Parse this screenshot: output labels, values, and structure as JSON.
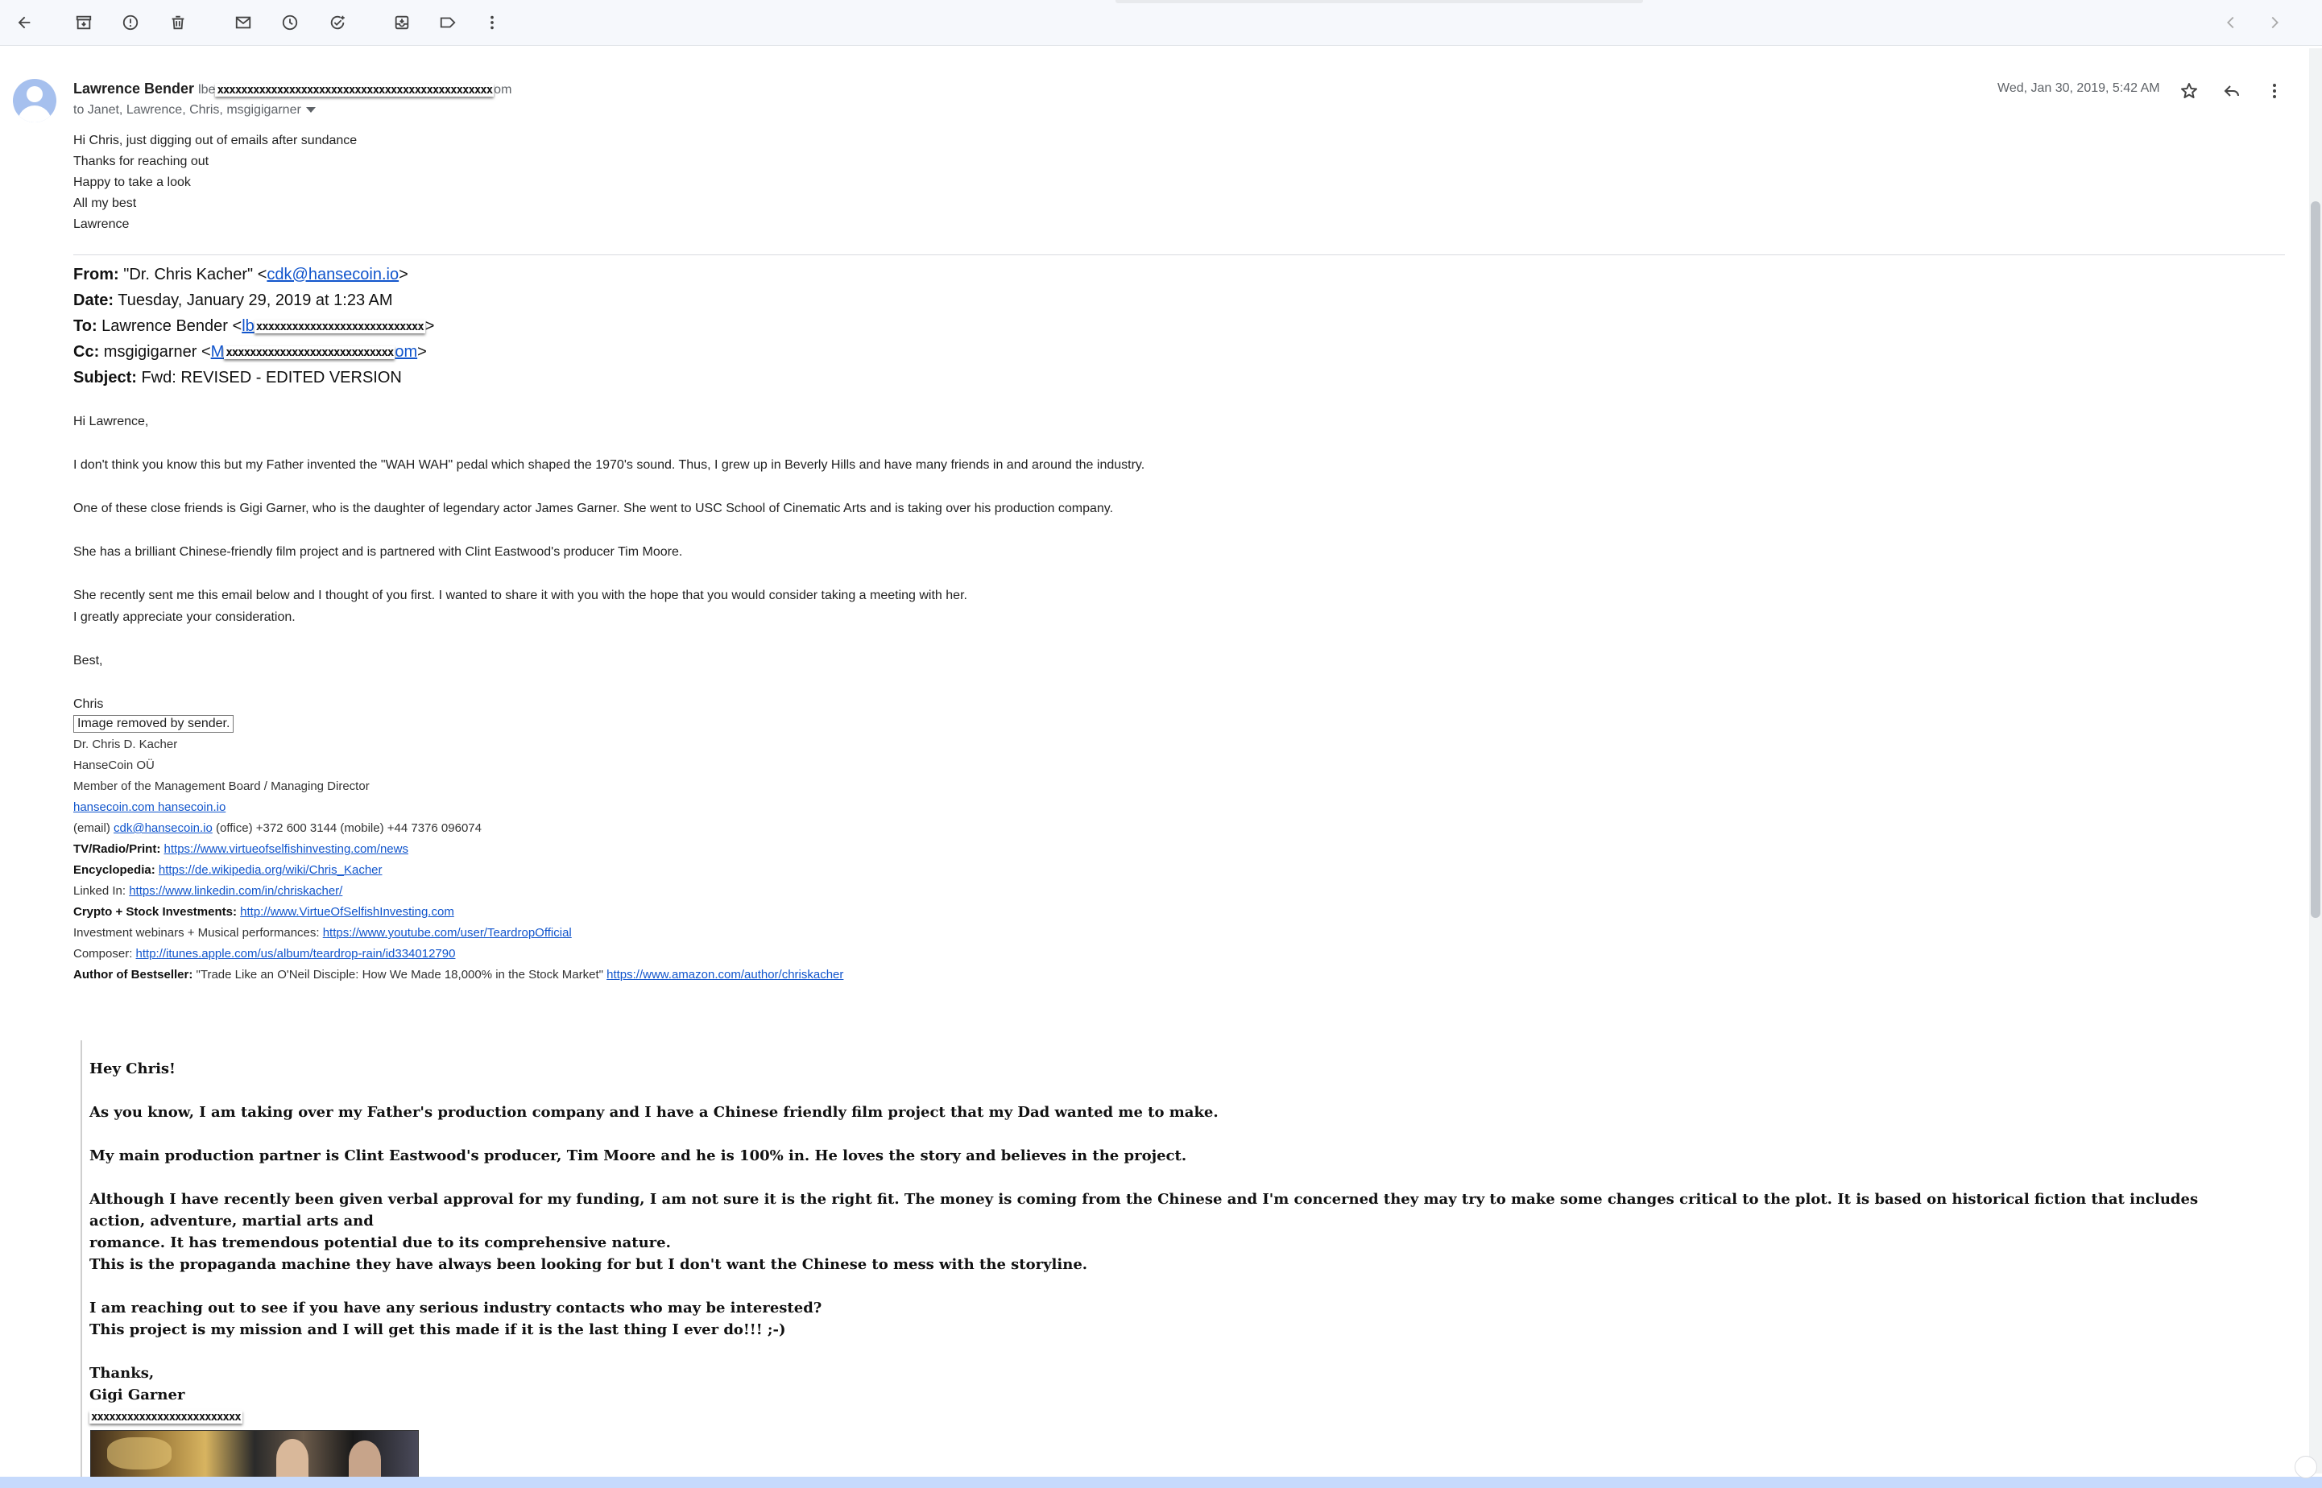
{
  "toolbar": {
    "icons": [
      "back-arrow-icon",
      "archive-icon",
      "report-spam-icon",
      "delete-icon",
      "mark-unread-icon",
      "snooze-icon",
      "add-task-icon",
      "move-to-icon",
      "label-icon",
      "more-vert-icon",
      "prev-chevron-icon",
      "next-chevron-icon"
    ]
  },
  "header": {
    "sender_name": "Lawrence Bender",
    "sender_addr_prefix": "lbe",
    "sender_addr_redacted": "xxxxxxxxxxxxxxxxxxxxxxxxxxxxxxxxxxxxxxxxxxxxxx",
    "sender_addr_suffix": "om",
    "recipients": "to Janet, Lawrence, Chris, msgigigarner",
    "date": "Wed, Jan 30, 2019, 5:42 AM"
  },
  "reply": {
    "lines": [
      "Hi Chris, just digging out of emails after sundance",
      "Thanks for reaching out",
      "Happy to take a look",
      "All my best",
      "Lawrence"
    ]
  },
  "forward": {
    "from_label": "From:",
    "from_value": "\"Dr. Chris Kacher\" <",
    "from_email": "cdk@hansecoin.io",
    "from_close": ">",
    "date_label": "Date:",
    "date_value": "Tuesday, January 29, 2019 at 1:23 AM",
    "to_label": "To:",
    "to_value": "Lawrence Bender <",
    "to_link_start": "lb",
    "to_redacted": "xxxxxxxxxxxxxxxxxxxxxxxxxxxx",
    "to_close": ">",
    "cc_label": "Cc:",
    "cc_value": "msgigigarner <",
    "cc_link_start": "M",
    "cc_redacted": "xxxxxxxxxxxxxxxxxxxxxxxxxxxx",
    "cc_link_end": "om",
    "cc_close": ">",
    "subject_label": "Subject:",
    "subject_value": "Fwd: REVISED - EDITED VERSION"
  },
  "body": {
    "greeting": "Hi Lawrence,",
    "p1": "I don't think you know this but my Father invented the \"WAH WAH\" pedal which shaped the 1970's sound.  Thus, I grew up in Beverly Hills and have many friends in and around the industry.",
    "p2": "One of these close friends is Gigi Garner, who is the daughter of legendary actor James Garner. She went to USC School of Cinematic Arts and is taking over his production company.",
    "p3": "She has a brilliant Chinese-friendly film project and is partnered with Clint Eastwood's producer Tim Moore.",
    "p4a": "She recently sent me this email below and I thought of you first. I wanted to share it with you with the hope that you would consider taking a meeting with her.",
    "p4b": "I greatly appreciate your consideration.",
    "closing": "Best,",
    "name": "Chris"
  },
  "signature": {
    "img_alt": "Image removed by sender.",
    "l1": "Dr. Chris D. Kacher",
    "l2": "HanseCoin OÜ",
    "l3": "Member of the Management Board / Managing Director",
    "l4_link": "hansecoin.com hansecoin.io",
    "l5_a": "(email)   ",
    "l5_link": "cdk@hansecoin.io",
    "l5_b": "   (office)  +372 600 3144  (mobile) +44 7376 096074",
    "l6_label": "TV/Radio/Print:",
    "l6_link": "https://www.virtueofselfishinvesting.com/news",
    "l7_label": "Encyclopedia:",
    "l7_link": "https://de.wikipedia.org/wiki/Chris_Kacher",
    "l8_label": "Linked In:",
    "l8_link": "https://www.linkedin.com/in/chriskacher/",
    "l9_label": "Crypto + Stock Investments:",
    "l9_link": "http://www.VirtueOfSelfishInvesting.com",
    "l10_label": "Investment webinars + Musical performances:",
    "l10_link": "https://www.youtube.com/user/TeardropOfficial",
    "l11_label": "Composer:",
    "l11_link": "http://itunes.apple.com/us/album/teardrop-rain/id334012790",
    "l12_label": "Author of Bestseller:",
    "l12_text": "\"Trade Like an O'Neil Disciple: How We Made 18,000% in the Stock Market\"",
    "l12_link": "https://www.amazon.com/author/chriskacher"
  },
  "quoted": {
    "q1": "Hey Chris!",
    "q2": "As you know, I am taking over my Father's production company and I have a Chinese friendly film project that my Dad wanted me to make.",
    "q3": "My main production partner is Clint Eastwood's producer, Tim Moore and he is 100% in. He loves the story and believes in the project.",
    "q4a": "Although I have recently been given verbal approval for my funding, I am not sure it is the right fit. The money is coming from the Chinese and I'm concerned they may try to make some changes critical to the plot.  It is based on historical fiction that includes action, adventure, martial arts and",
    "q4b": "romance. It has tremendous potential due to its comprehensive nature.",
    "q4c": "This is the propaganda machine they have always been looking for but I don't want the Chinese to mess with the storyline.",
    "q5a": "I am reaching out to see if  you have any serious industry contacts who may be interested?",
    "q5b": "This project is my mission and I will get this made if it is the last thing I ever do!!!   ;-)",
    "q6": "Thanks,",
    "q7": "Gigi Garner",
    "q8_redacted": "xxxxxxxxxxxxxxxxxxxxxxxxx"
  }
}
